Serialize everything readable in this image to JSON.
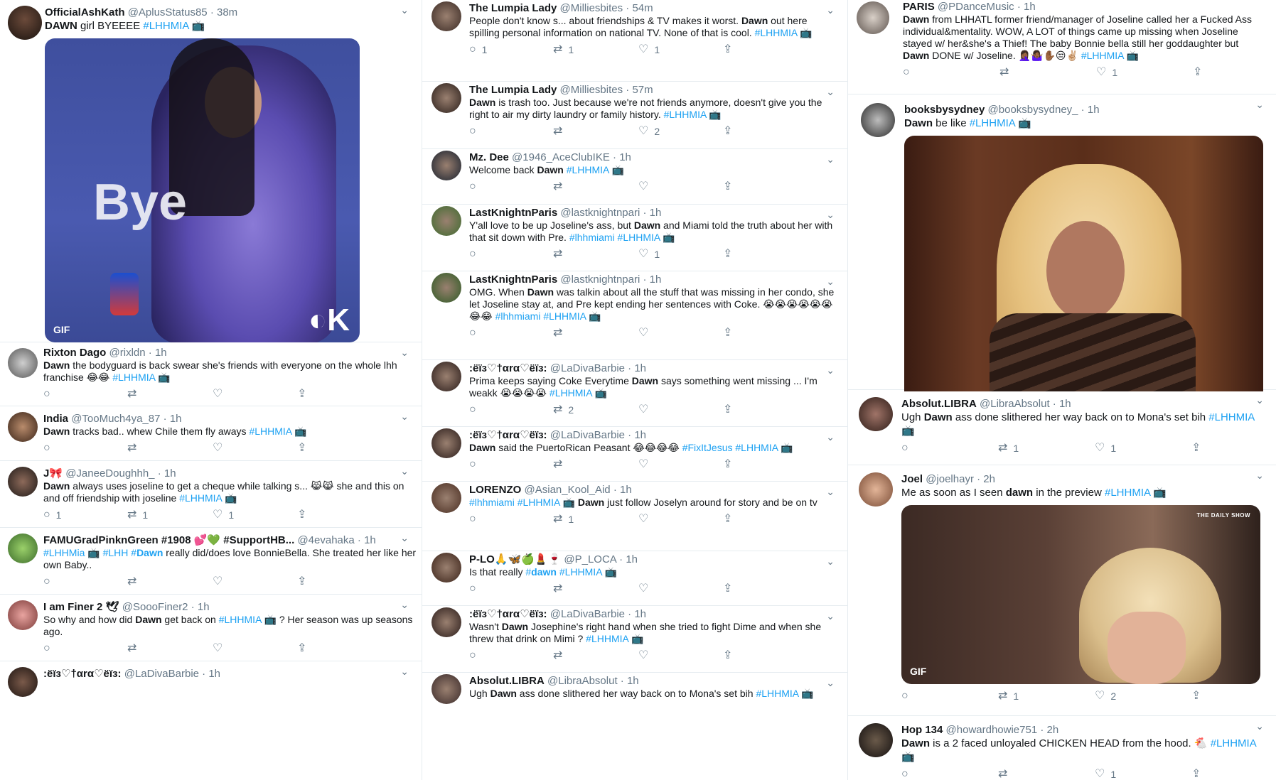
{
  "col1": [
    {
      "name": "OfficialAshKath",
      "handle": "@AplusStatus85",
      "time": "38m",
      "text": "DAWN girl BYEEEE #LHHMIA 📺",
      "likes": "",
      "retweets": "",
      "replies": "",
      "media": "Bye GIF",
      "media_caption": "Bye",
      "gif": "GIF"
    },
    {
      "name": "Rixton Dago",
      "handle": "@rixldn",
      "time": "1h",
      "text": "Dawn the bodyguard is back swear she's friends with everyone on the whole lhh franchise 😂😂 #LHHMIA 📺",
      "likes": "",
      "retweets": "",
      "replies": ""
    },
    {
      "name": "India",
      "handle": "@TooMuch4ya_87",
      "time": "1h",
      "text": "Dawn tracks bad.. whew Chile them fly aways #LHHMIA 📺",
      "likes": "",
      "retweets": "",
      "replies": ""
    },
    {
      "name": "J🎀",
      "handle": "@JaneeDoughhh_",
      "time": "1h",
      "text": "Dawn always uses joseline to get a cheque while talking s... 😹😹 she and this on and off friendship with joseline #LHHMIA 📺",
      "likes": "1",
      "retweets": "1",
      "replies": "1"
    },
    {
      "name": "FAMUGradPinknGreen #1908 💕💚 #SupportHB...",
      "handle": "@4evahaka",
      "time": "1h",
      "text": "#LHHMia 📺 #LHH #Dawn really did/does love BonnieBella. She treated her like her own Baby..",
      "likes": "",
      "retweets": "",
      "replies": ""
    },
    {
      "name": "I am Finer 2 🕊",
      "handle": "@SoooFiner2",
      "time": "1h",
      "text": "So why and how did Dawn get back on #LHHMIA 📺 ? Her season was up seasons ago.",
      "likes": "",
      "retweets": "",
      "replies": ""
    },
    {
      "name": ":ёїз♡†αrα♡ёїз:",
      "handle": "@LaDivaBarbie",
      "time": "1h",
      "text": "",
      "likes": "",
      "retweets": "",
      "replies": ""
    }
  ],
  "col2": [
    {
      "name": "The Lumpia Lady",
      "handle": "@Milliesbites",
      "time": "54m",
      "text": "People don't know s... about friendships & TV makes it worst. Dawn out here spilling personal information on national TV. None of that is cool. #LHHMIA 📺",
      "replies": "1",
      "retweets": "1",
      "likes": "1"
    },
    {
      "name": "The Lumpia Lady",
      "handle": "@Milliesbites",
      "time": "57m",
      "text": "Dawn is trash too. Just because we're not friends anymore, doesn't give you the right to air my dirty laundry or family history. #LHHMIA 📺",
      "replies": "",
      "retweets": "",
      "likes": "2"
    },
    {
      "name": "Mz. Dee",
      "handle": "@1946_AceClubIKE",
      "time": "1h",
      "text": "Welcome back Dawn #LHHMIA 📺",
      "replies": "",
      "retweets": "",
      "likes": ""
    },
    {
      "name": "LastKnightnParis",
      "handle": "@lastknightnpari",
      "time": "1h",
      "text": "Y'all love to be up Joseline's ass, but Dawn and Miami told the truth about her with that sit down with Pre. #lhhmiami #LHHMIA 📺",
      "replies": "",
      "retweets": "",
      "likes": "1"
    },
    {
      "name": "LastKnightnParis",
      "handle": "@lastknightnpari",
      "time": "1h",
      "text": "OMG. When Dawn was talkin about all the stuff that was missing in her condo, she let Joseline stay at, and Pre kept ending her sentences with Coke. 😭😭😭😭😭😭😂😂 #lhhmiami #LHHMIA 📺",
      "replies": "",
      "retweets": "",
      "likes": ""
    },
    {
      "name": ":ёїз♡†αrα♡ёїз:",
      "handle": "@LaDivaBarbie",
      "time": "1h",
      "text": "Prima keeps saying Coke Everytime Dawn says something went missing ... I'm weakk 😭😭😭😭 #LHHMIA 📺",
      "replies": "",
      "retweets": "2",
      "likes": ""
    },
    {
      "name": ":ёїз♡†αrα♡ёїз:",
      "handle": "@LaDivaBarbie",
      "time": "1h",
      "text": "Dawn said the PuertoRican Peasant 😂😂😂😂 #FixItJesus #LHHMIA 📺",
      "replies": "",
      "retweets": "",
      "likes": ""
    },
    {
      "name": "LORENZO",
      "handle": "@Asian_Kool_Aid",
      "time": "1h",
      "text": "#lhhmiami #LHHMIA 📺 Dawn just follow Joselyn around for story and be on tv",
      "replies": "",
      "retweets": "1",
      "likes": ""
    },
    {
      "name": "P-LO🙏🦋🍏💄🍷",
      "handle": "@P_LOCA",
      "time": "1h",
      "text": "Is that really #dawn #LHHMIA 📺",
      "replies": "",
      "retweets": "",
      "likes": ""
    },
    {
      "name": ":ёїз♡†αrα♡ёїз:",
      "handle": "@LaDivaBarbie",
      "time": "1h",
      "text": "Wasn't Dawn Josephine's right hand when she tried to fight Dime and when she threw that drink on Mimi ? #LHHMIA 📺",
      "replies": "",
      "retweets": "",
      "likes": ""
    },
    {
      "name": "Absolut.LIBRA",
      "handle": "@LibraAbsolut",
      "time": "1h",
      "text": "Ugh Dawn ass done slithered her way back on to Mona's set bih #LHHMIA 📺",
      "replies": "",
      "retweets": "",
      "likes": ""
    }
  ],
  "col3": [
    {
      "name": "PARIS",
      "handle": "@PDanceMusic",
      "time": "1h",
      "text": "Dawn from LHHATL former friend/manager of Joseline called her a Fucked Ass individual&mentality. WOW, A LOT of things came up missing when Joseline stayed w/ her&she's a Thief! The baby Bonnie bella still her goddaughter but Dawn DONE w/ Joseline. 🤦🏾‍♀️🤷🏾‍♀️✋🏾😒✌🏼 #LHHMIA 📺",
      "replies": "",
      "retweets": "",
      "likes": "1"
    },
    {
      "name": "booksbysydney",
      "handle": "@booksbysydney_",
      "time": "1h",
      "text": "Dawn be like #LHHMIA 📺",
      "replies": "",
      "retweets": "",
      "likes": "",
      "media": "blonde wig GIF",
      "gif": ""
    },
    {
      "name": "Absolut.LIBRA",
      "handle": "@LibraAbsolut",
      "time": "1h",
      "text": "Ugh Dawn ass done slithered her way back on to Mona's set bih #LHHMIA 📺",
      "replies": "",
      "retweets": "1",
      "likes": "1"
    },
    {
      "name": "Joel",
      "handle": "@joelhayr",
      "time": "2h",
      "text": "Me as soon as I seen dawn in the preview #LHHMIA 📺",
      "replies": "",
      "retweets": "1",
      "likes": "2",
      "media": "The Daily Show GIF",
      "gif": "GIF",
      "watermark": "THE DAILY SHOW"
    },
    {
      "name": "Hop 134",
      "handle": "@howardhowie751",
      "time": "2h",
      "text": "Dawn is a 2 faced unloyaled CHICKEN HEAD from the hood. 🐔 #LHHMIA 📺",
      "replies": "",
      "retweets": "",
      "likes": "1"
    }
  ],
  "icons": {
    "reply": "reply-icon",
    "retweet": "retweet-icon",
    "like": "heart-icon",
    "share": "share-icon",
    "more": "chevron-down-icon"
  },
  "colors": {
    "link": "#1da1f2",
    "text": "#14171a",
    "muted": "#657786",
    "border": "#e6ecf0"
  }
}
